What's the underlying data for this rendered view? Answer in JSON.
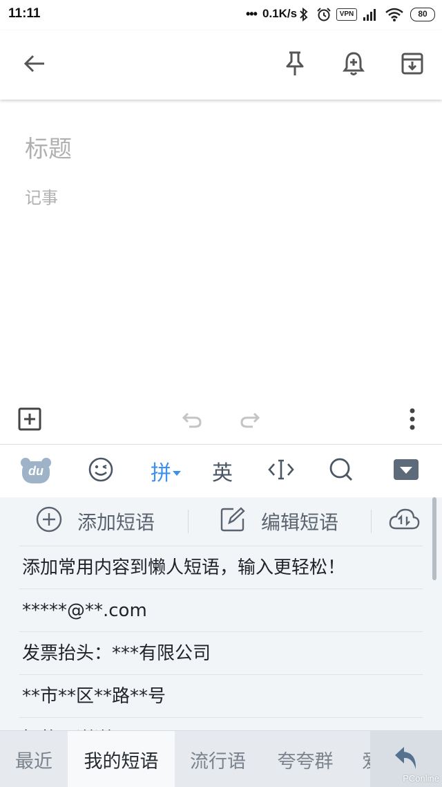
{
  "status_bar": {
    "time": "11:11",
    "dots": "•••",
    "speed": "0.1K/s",
    "vpn": "VPN",
    "battery": "80",
    "icons": [
      "bluetooth-icon",
      "alarm-icon",
      "vpn-icon",
      "signal-icon",
      "wifi-icon",
      "battery-icon"
    ]
  },
  "app_bar": {
    "icons": [
      "back-arrow-icon",
      "pin-icon",
      "reminder-bell-icon",
      "archive-icon"
    ]
  },
  "note": {
    "title_placeholder": "标题",
    "body_placeholder": "记事"
  },
  "editor_toolbar": {
    "icons": [
      "add-box-icon",
      "undo-icon",
      "redo-icon",
      "more-vert-icon"
    ]
  },
  "ime_bar": {
    "logo": "du",
    "pinyin_label": "拼",
    "english_label": "英",
    "icons": [
      "du-logo-icon",
      "emoji-icon",
      "cursor-icon",
      "search-icon",
      "collapse-keyboard-icon"
    ]
  },
  "phrase_panel": {
    "add_label": "添加短语",
    "edit_label": "编辑短语",
    "phrases": [
      "添加常用内容到懒人短语，输入更轻松！",
      "*****@**.com",
      "发票抬头：***有限公司",
      "**市**区**路**号",
      "好的，谢谢！"
    ]
  },
  "ime_tabs": {
    "tabs": [
      "最近",
      "我的短语",
      "流行语",
      "夸夸群",
      "爱"
    ],
    "active_index": 1,
    "watermark": "PConline"
  },
  "colors": {
    "ime_accent": "#3d8ff0",
    "panel_bg": "#f2f5f8",
    "placeholder": "#b0b0b0"
  }
}
